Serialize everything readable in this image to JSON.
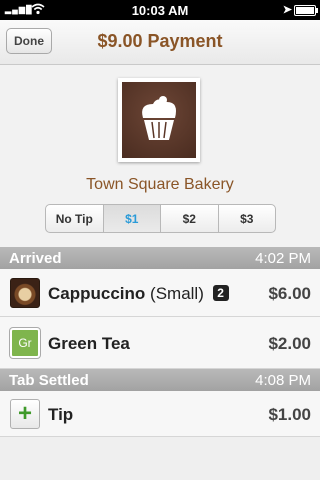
{
  "status_bar": {
    "time": "10:03 AM",
    "signal_icon": "signal-bars-icon",
    "wifi_icon": "wifi-icon",
    "location_icon": "location-arrow-icon",
    "battery_icon": "battery-icon"
  },
  "nav": {
    "done_label": "Done",
    "title": "$9.00 Payment"
  },
  "merchant": {
    "name": "Town Square Bakery",
    "logo_icon": "cupcake-icon"
  },
  "tip_options": [
    {
      "label": "No Tip",
      "selected": false
    },
    {
      "label": "$1",
      "selected": true
    },
    {
      "label": "$2",
      "selected": false
    },
    {
      "label": "$3",
      "selected": false
    }
  ],
  "sections": {
    "arrived": {
      "title": "Arrived",
      "time": "4:02 PM",
      "items": [
        {
          "name": "Cappuccino",
          "size": "(Small)",
          "qty": "2",
          "price": "$6.00",
          "thumb": "cappuccino-thumbnail"
        },
        {
          "name": "Green Tea",
          "thumb_text": "Gr",
          "price": "$2.00",
          "thumb": "green-tea-thumbnail"
        }
      ]
    },
    "settled": {
      "title": "Tab Settled",
      "time": "4:08 PM",
      "tip": {
        "label": "Tip",
        "price": "$1.00",
        "icon": "plus-icon"
      }
    }
  },
  "colors": {
    "accent_brown": "#8a5527",
    "selected_blue": "#2a9bd8",
    "header_gray": "#a9a9a9",
    "tea_green": "#7fb54d",
    "plus_green": "#3f9a2a"
  }
}
